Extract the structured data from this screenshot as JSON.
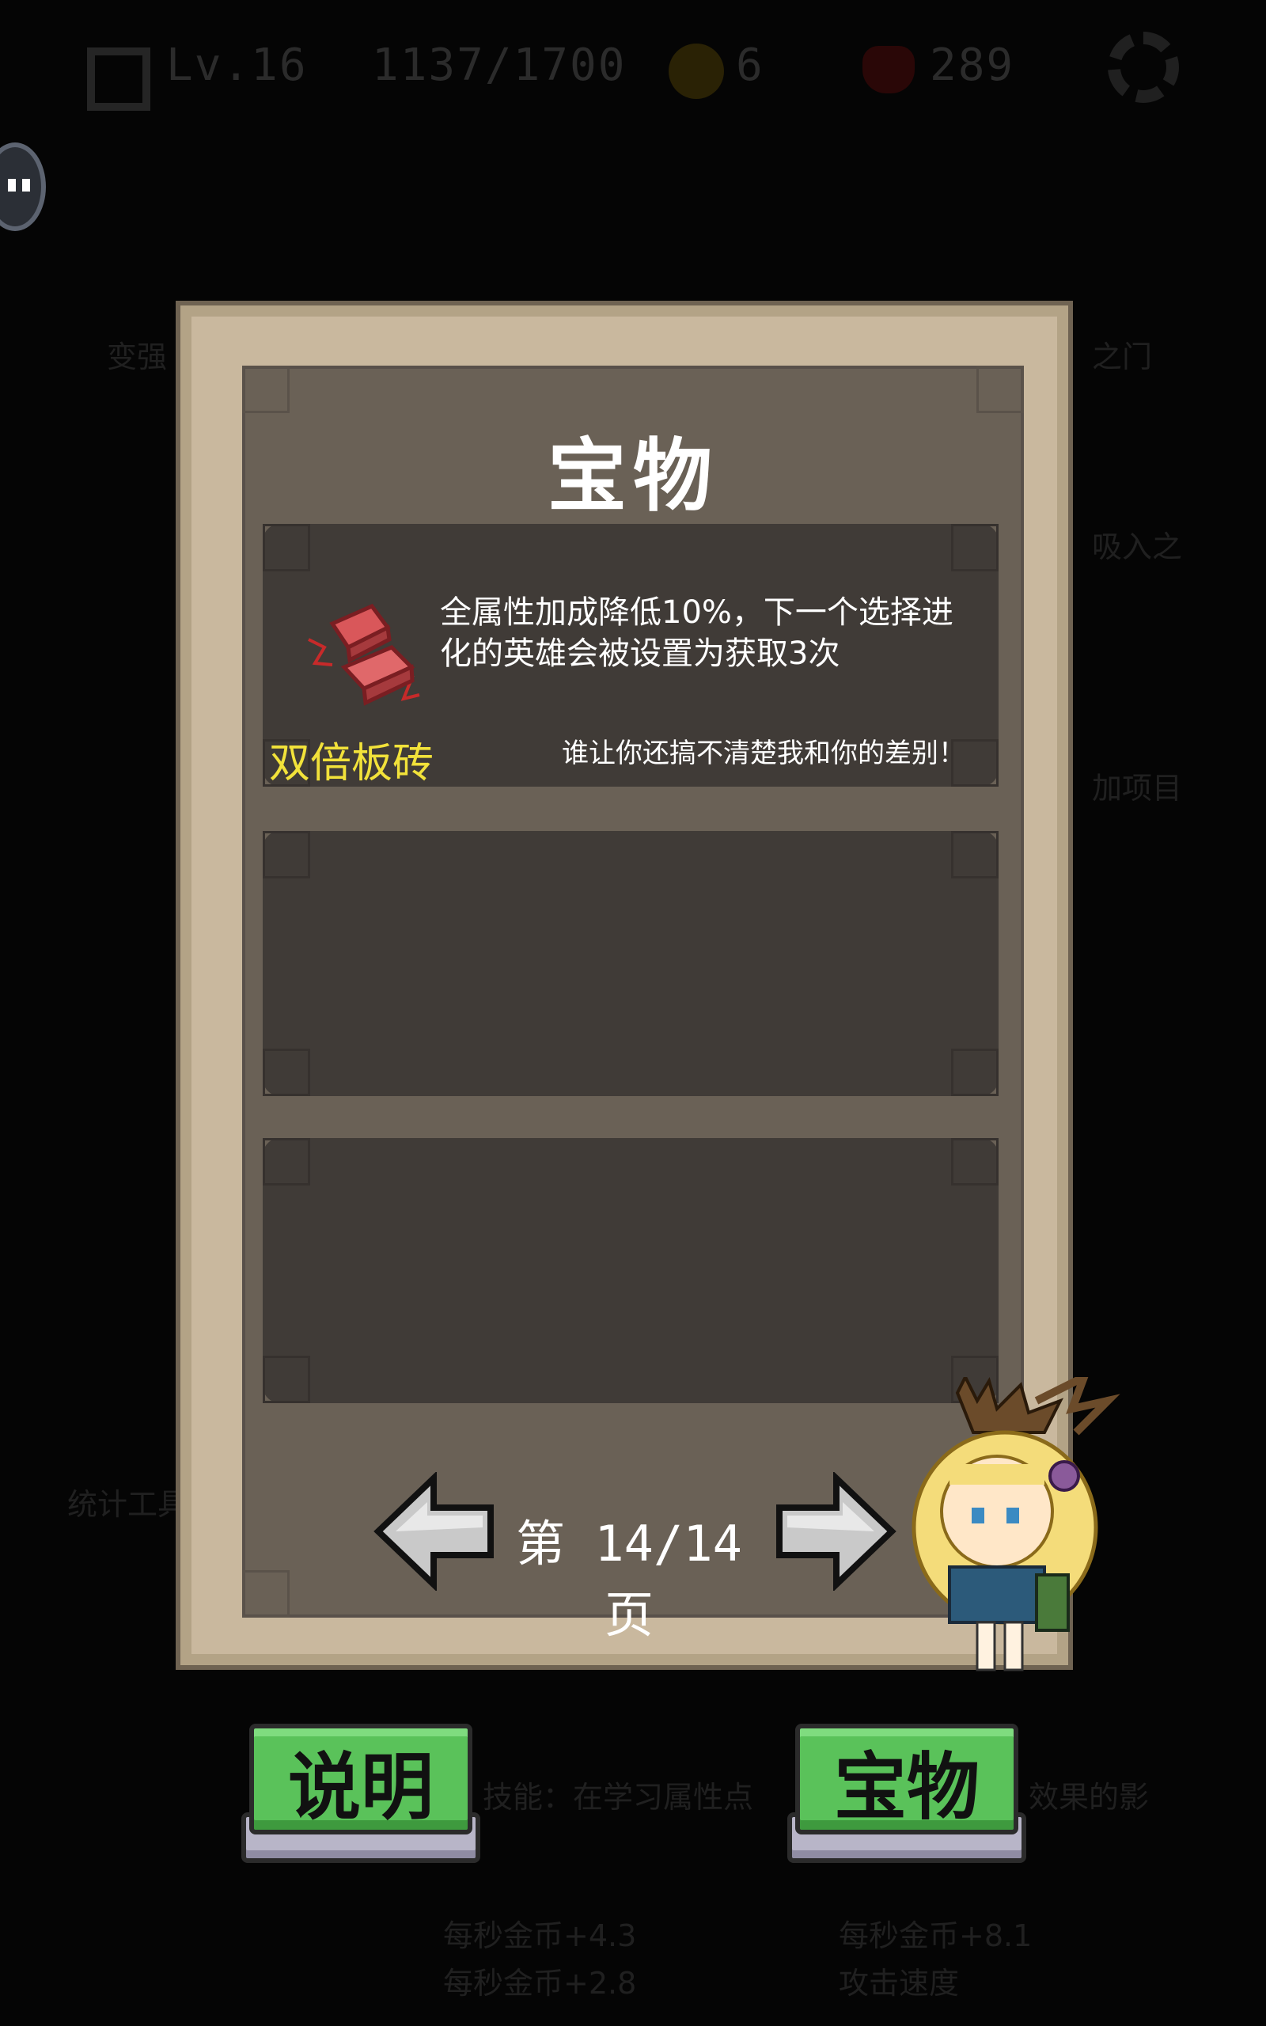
{
  "hud": {
    "level": "Lv.16",
    "xp": "1137/1700",
    "coins": "6",
    "hearts": "289"
  },
  "background": {
    "left_labels": [
      "变强",
      "统计工具"
    ],
    "right_labels": [
      "之门",
      "吸入之",
      "加项目"
    ],
    "bottom_left_lines": [
      "每秒金币+4.3",
      "每秒金币+2.8"
    ],
    "bottom_right_lines": [
      "每秒金币+8.1",
      "攻击速度"
    ],
    "mid_text_left": "技能：在学习属性点",
    "mid_text_right": "效果的影"
  },
  "panel": {
    "title": "宝物",
    "items": [
      {
        "name": "双倍板砖",
        "description": "全属性加成降低10%，下一个选择进化的英雄会被设置为获取3次",
        "quote": "谁让你还搞不清楚我和你的差别！",
        "icon": "bricks-icon"
      }
    ],
    "empty_slots": 2,
    "pagination": {
      "text": "第 14/14 页",
      "current": 14,
      "total": 14
    }
  },
  "buttons": {
    "help": "说明",
    "treasure": "宝物"
  },
  "colors": {
    "item_name": "#f2e23a",
    "button_green": "#5ac25a",
    "panel_frame": "#c9b89e",
    "panel_inner": "#6a6156",
    "slot": "#403b37"
  }
}
